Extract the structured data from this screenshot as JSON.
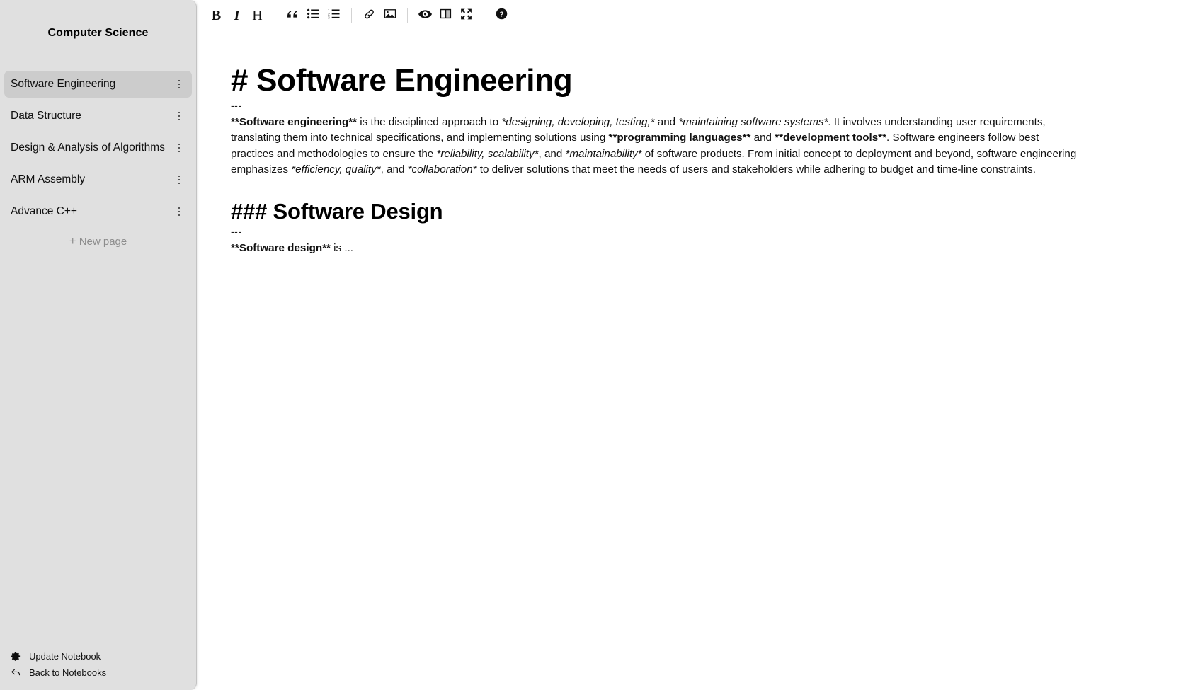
{
  "sidebar": {
    "notebook_title": "Computer Science",
    "pages": [
      {
        "label": "Software Engineering",
        "active": true
      },
      {
        "label": "Data Structure",
        "active": false
      },
      {
        "label": "Design & Analysis of Algorithms",
        "active": false
      },
      {
        "label": "ARM Assembly",
        "active": false
      },
      {
        "label": "Advance C++",
        "active": false
      }
    ],
    "new_page_label": "New page",
    "new_page_plus": "+",
    "footer": {
      "update_notebook_label": "Update Notebook",
      "back_to_notebooks_label": "Back to Notebooks"
    }
  },
  "toolbar": {
    "items": [
      {
        "name": "bold",
        "glyph": "B"
      },
      {
        "name": "italic",
        "glyph": "I"
      },
      {
        "name": "heading",
        "glyph": "H"
      },
      {
        "name": "quote",
        "glyph": "❝"
      },
      {
        "name": "unordered-list",
        "glyph": ""
      },
      {
        "name": "ordered-list",
        "glyph": ""
      },
      {
        "name": "link",
        "glyph": ""
      },
      {
        "name": "image",
        "glyph": ""
      },
      {
        "name": "preview",
        "glyph": ""
      },
      {
        "name": "side-by-side",
        "glyph": ""
      },
      {
        "name": "fullscreen",
        "glyph": ""
      },
      {
        "name": "help",
        "glyph": "?"
      }
    ]
  },
  "editor": {
    "h1": "# Software Engineering",
    "rule1": "---",
    "paragraph1": {
      "segments": [
        {
          "text": "**Software engineering**",
          "style": "bold"
        },
        {
          "text": " is the disciplined approach to ",
          "style": "normal"
        },
        {
          "text": "*designing, developing, testing,*",
          "style": "italic"
        },
        {
          "text": " and ",
          "style": "normal"
        },
        {
          "text": "*maintaining software systems*",
          "style": "italic"
        },
        {
          "text": ". It involves understanding user requirements, translating them into technical specifications, and implementing solutions using ",
          "style": "normal"
        },
        {
          "text": "**programming languages**",
          "style": "bold"
        },
        {
          "text": " and ",
          "style": "normal"
        },
        {
          "text": "**development tools**",
          "style": "bold"
        },
        {
          "text": ". Software engineers follow best practices and methodologies to ensure the ",
          "style": "normal"
        },
        {
          "text": "*reliability, scalability*",
          "style": "italic"
        },
        {
          "text": ", and ",
          "style": "normal"
        },
        {
          "text": "*maintainability*",
          "style": "italic"
        },
        {
          "text": " of software products. From initial concept to deployment and beyond, software engineering emphasizes ",
          "style": "normal"
        },
        {
          "text": "*efficiency, quality*",
          "style": "italic"
        },
        {
          "text": ", and ",
          "style": "normal"
        },
        {
          "text": "*collaboration*",
          "style": "italic"
        },
        {
          "text": " to deliver solutions that meet the needs of users and stakeholders while adhering to budget and time-line constraints.",
          "style": "normal"
        }
      ]
    },
    "h3": "### Software Design",
    "rule2": "---",
    "paragraph2": {
      "segments": [
        {
          "text": "**Software design**",
          "style": "bold"
        },
        {
          "text": " is ...",
          "style": "normal"
        }
      ]
    }
  },
  "colors": {
    "sidebar_bg": "#e0e0e0",
    "sidebar_active": "#cccccc",
    "main_bg": "#ffffff",
    "text": "#111111",
    "muted": "#8d8d8d"
  }
}
